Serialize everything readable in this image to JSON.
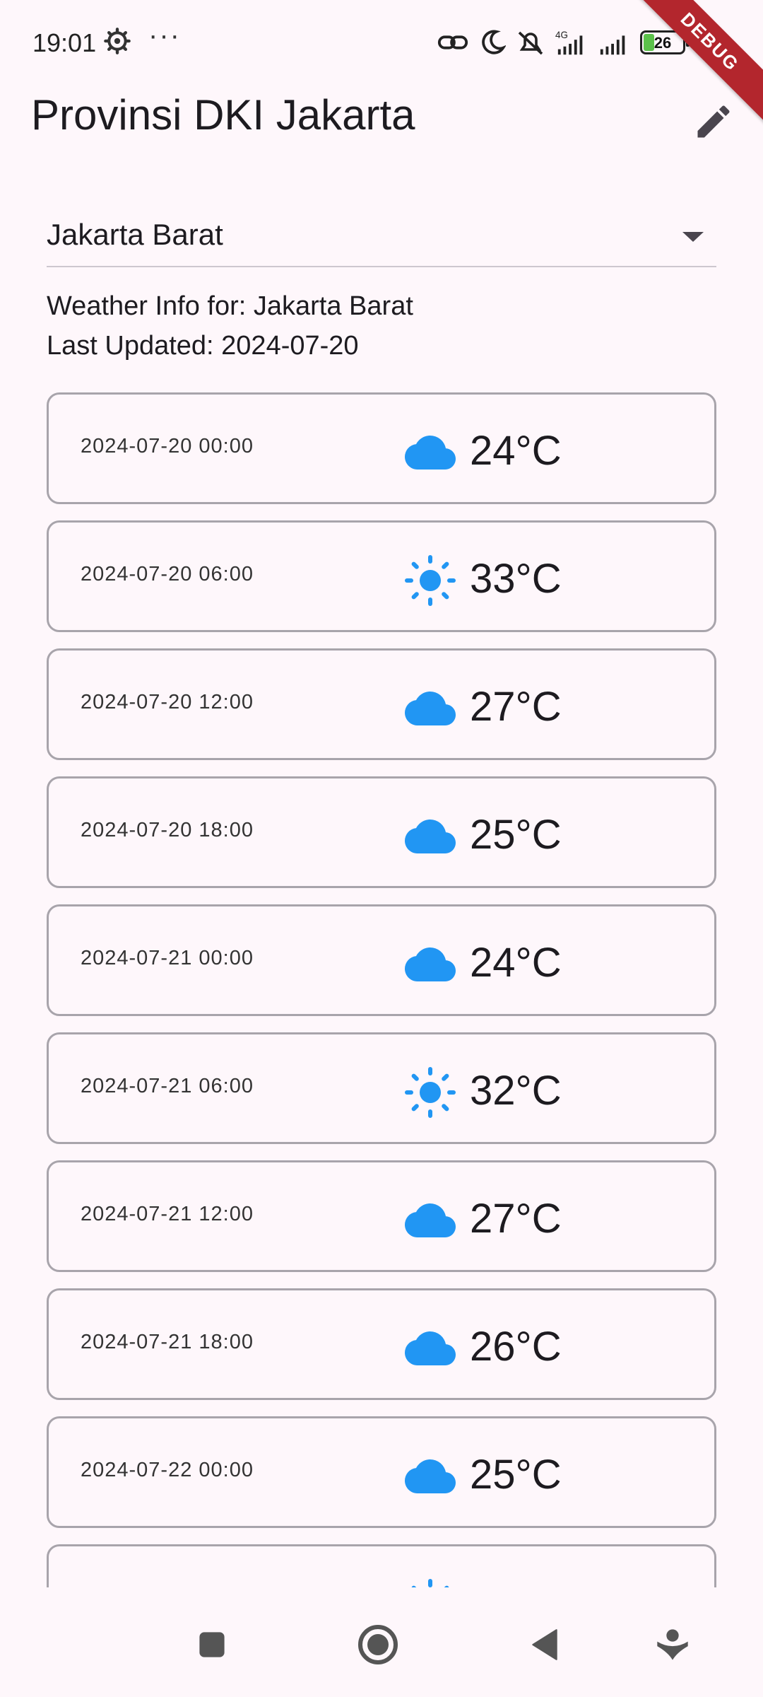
{
  "status_bar": {
    "time": "19:01",
    "more": "···",
    "network": "4G",
    "battery_level": "26",
    "battery_fraction": 0.26
  },
  "debug_banner": "DEBUG",
  "app_bar": {
    "title": "Provinsi DKI Jakarta",
    "edit_icon": "pencil-icon"
  },
  "dropdown": {
    "selected": "Jakarta Barat"
  },
  "info": {
    "weather_for": "Weather Info for: Jakarta Barat",
    "last_updated": "Last Updated: 2024-07-20"
  },
  "colors": {
    "accent": "#2196f3",
    "background": "#fef7fb",
    "card_border": "#a8a4ab",
    "debug": "#b3262d"
  },
  "forecast": [
    {
      "time": "2024-07-20 00:00",
      "icon": "cloud-icon",
      "temp": "24°C"
    },
    {
      "time": "2024-07-20 06:00",
      "icon": "sun-icon",
      "temp": "33°C"
    },
    {
      "time": "2024-07-20 12:00",
      "icon": "cloud-icon",
      "temp": "27°C"
    },
    {
      "time": "2024-07-20 18:00",
      "icon": "cloud-icon",
      "temp": "25°C"
    },
    {
      "time": "2024-07-21 00:00",
      "icon": "cloud-icon",
      "temp": "24°C"
    },
    {
      "time": "2024-07-21 06:00",
      "icon": "sun-icon",
      "temp": "32°C"
    },
    {
      "time": "2024-07-21 12:00",
      "icon": "cloud-icon",
      "temp": "27°C"
    },
    {
      "time": "2024-07-21 18:00",
      "icon": "cloud-icon",
      "temp": "26°C"
    },
    {
      "time": "2024-07-22 00:00",
      "icon": "cloud-icon",
      "temp": "25°C"
    },
    {
      "time": "",
      "icon": "sun-icon",
      "temp": ""
    }
  ],
  "nav": {
    "recents_icon": "square-icon",
    "home_icon": "circle-icon",
    "back_icon": "triangle-back-icon",
    "assistant_icon": "accessibility-icon"
  }
}
